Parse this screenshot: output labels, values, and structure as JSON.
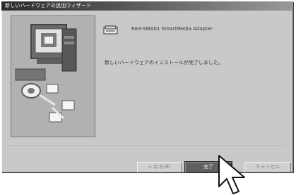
{
  "window": {
    "title": "新しいハードウェアの追加ウィザード"
  },
  "content": {
    "device_name": "REX-SMA01 SmartMedia Adapter",
    "message": "新しいハードウェアのインストールが完了しました。"
  },
  "buttons": {
    "back": "< 戻る(B)",
    "finish": "完了",
    "cancel": "キャンセル"
  },
  "icons": {
    "device": "card-reader-icon",
    "illustration": "computer-install-illustration",
    "cursor": "mouse-pointer-icon"
  }
}
